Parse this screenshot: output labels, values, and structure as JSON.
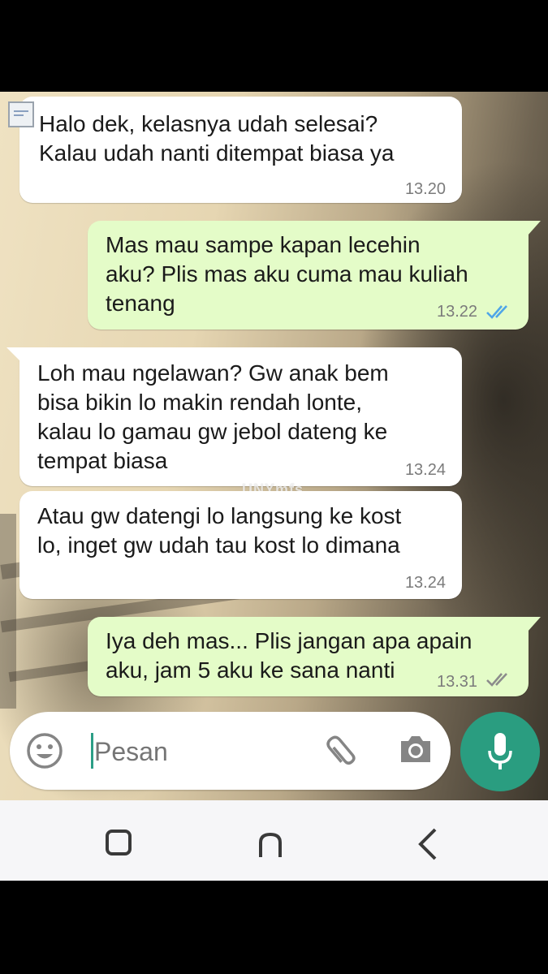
{
  "messages": [
    {
      "direction": "incoming",
      "text": "Halo dek, kelasnya udah selesai?\nKalau udah nanti ditempat biasa ya",
      "time": "13.20"
    },
    {
      "direction": "outgoing",
      "text": "Mas mau sampe kapan lecehin\naku? Plis mas aku cuma mau kuliah\ntenang",
      "time": "13.22",
      "status": "read"
    },
    {
      "direction": "incoming",
      "text": "Loh mau ngelawan? Gw anak bem\nbisa bikin lo makin rendah lonte,\nkalau lo gamau gw jebol dateng ke\ntempat biasa",
      "time": "13.24"
    },
    {
      "direction": "incoming",
      "text": "Atau gw datengi lo langsung ke kost\nlo, inget gw udah tau kost lo dimana",
      "time": "13.24"
    },
    {
      "direction": "outgoing",
      "text": "Iya deh mas... Plis jangan apa apain\naku, jam 5 aku ke sana nanti",
      "time": "13.31",
      "status": "delivered"
    }
  ],
  "watermark": "UNYmfs",
  "composer": {
    "placeholder": "Pesan",
    "icons": [
      "emoji-icon",
      "attach-icon",
      "camera-icon",
      "mic-icon"
    ]
  },
  "navbar": {
    "icons": [
      "recent-apps-icon",
      "home-icon",
      "back-icon"
    ]
  },
  "colors": {
    "incoming_bubble": "#ffffff",
    "outgoing_bubble": "#e4fcc8",
    "read_tick": "#4fa6e8",
    "delivered_tick": "#8c8c8c",
    "mic_button": "#2a9d80"
  }
}
